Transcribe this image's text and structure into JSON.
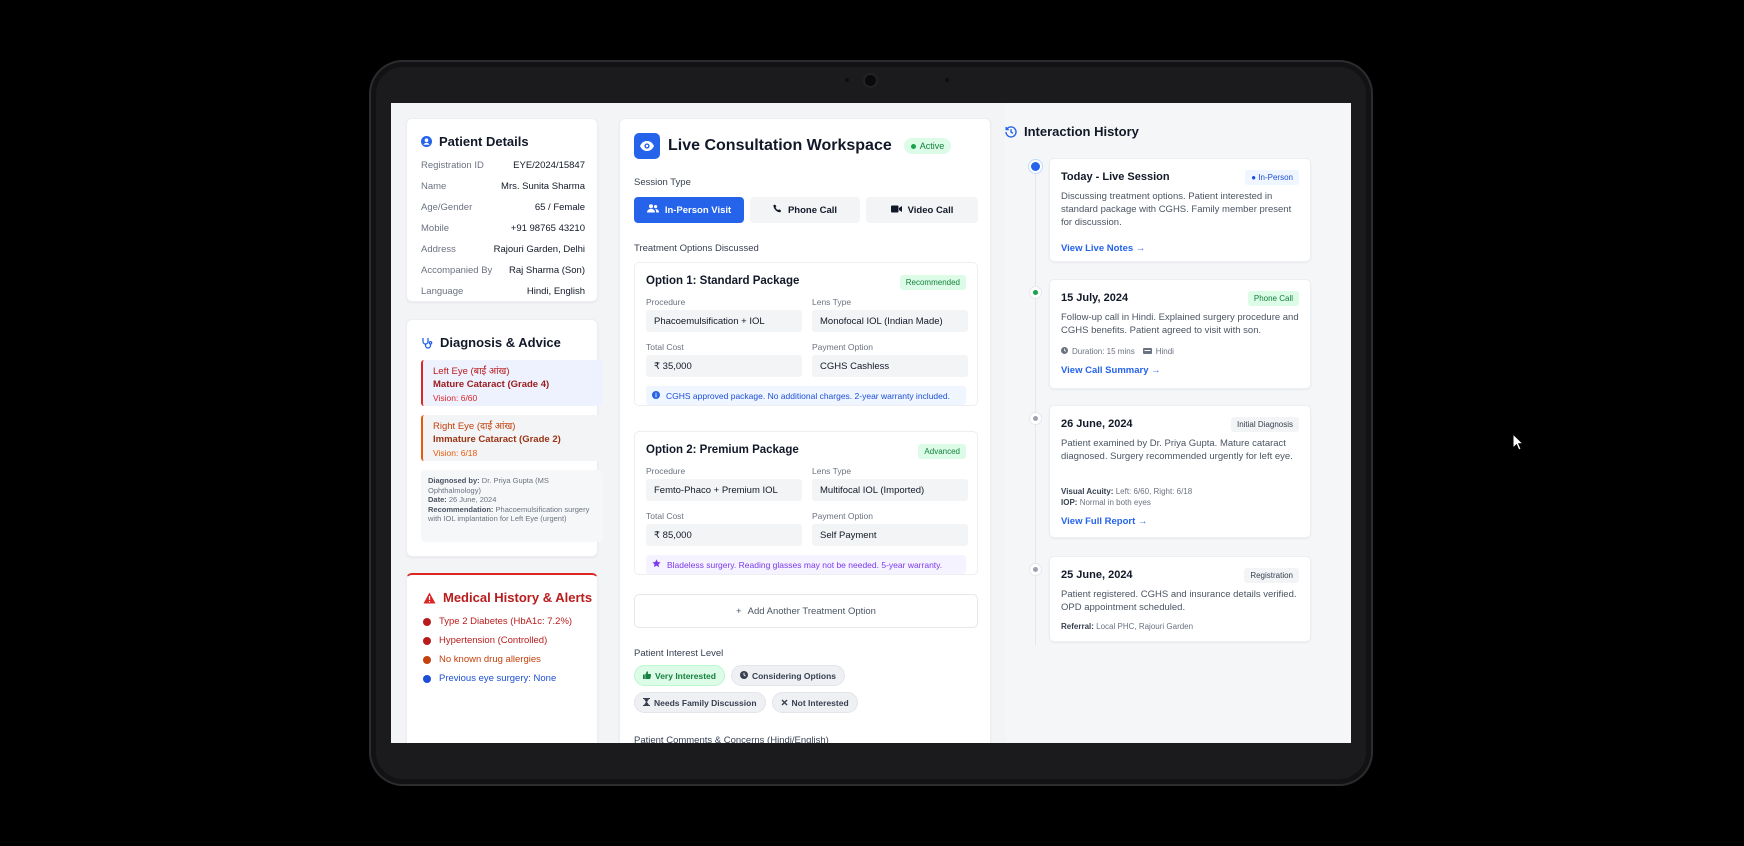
{
  "patient": {
    "title": "Patient Details",
    "rows": [
      {
        "label": "Registration ID",
        "value": "EYE/2024/15847"
      },
      {
        "label": "Name",
        "value": "Mrs. Sunita Sharma"
      },
      {
        "label": "Age/Gender",
        "value": "65 / Female"
      },
      {
        "label": "Mobile",
        "value": "+91 98765 43210"
      },
      {
        "label": "Address",
        "value": "Rajouri Garden, Delhi"
      },
      {
        "label": "Accompanied By",
        "value": "Raj Sharma (Son)"
      },
      {
        "label": "Language",
        "value": "Hindi, English"
      }
    ]
  },
  "diagnosis": {
    "title": "Diagnosis & Advice",
    "left": {
      "eye": "Left Eye (बाईं आंख)",
      "condition": "Mature Cataract (Grade 4)",
      "vision": "Vision: 6/60"
    },
    "right": {
      "eye": "Right Eye (दाईं आंख)",
      "condition": "Immature Cataract (Grade 2)",
      "vision": "Vision: 6/18"
    },
    "notes": {
      "by_label": "Diagnosed by:",
      "by_value": "Dr. Priya Gupta (MS Ophthalmology)",
      "date_label": "Date:",
      "date_value": "26 June, 2024",
      "rec_label": "Recommendation:",
      "rec_value": "Phacoemulsification surgery with IOL implantation for Left Eye (urgent)"
    }
  },
  "history": {
    "title": "Medical History & Alerts",
    "items": [
      {
        "text": "Type 2 Diabetes (HbA1c: 7.2%)",
        "color": "#b91c1c"
      },
      {
        "text": "Hypertension (Controlled)",
        "color": "#b91c1c"
      },
      {
        "text": "No known drug allergies",
        "color": "#c2410c"
      },
      {
        "text": "Previous eye surgery: None",
        "color": "#1d4ed8"
      }
    ]
  },
  "workspace": {
    "title": "Live Consultation Workspace",
    "status": "Active",
    "session_label": "Session Type",
    "sessions": [
      "In-Person Visit",
      "Phone Call",
      "Video Call"
    ],
    "treatment_label": "Treatment Options Discussed",
    "option1": {
      "title": "Option 1: Standard Package",
      "badge": "Recommended",
      "procedure_label": "Procedure",
      "procedure": "Phacoemulsification + IOL",
      "lens_label": "Lens Type",
      "lens": "Monofocal IOL (Indian Made)",
      "cost_label": "Total Cost",
      "cost": "₹ 35,000",
      "payment_label": "Payment Option",
      "payment": "CGHS Cashless",
      "note": "CGHS approved package. No additional charges. 2-year warranty included."
    },
    "option2": {
      "title": "Option 2: Premium Package",
      "badge": "Advanced",
      "procedure_label": "Procedure",
      "procedure": "Femto-Phaco + Premium IOL",
      "lens_label": "Lens Type",
      "lens": "Multifocal IOL (Imported)",
      "cost_label": "Total Cost",
      "cost": "₹ 85,000",
      "payment_label": "Payment Option",
      "payment": "Self Payment",
      "note": "Bladeless surgery. Reading glasses may not be needed. 5-year warranty."
    },
    "add_option": "Add Another Treatment Option",
    "interest_label": "Patient Interest Level",
    "interest": [
      "Very Interested",
      "Considering Options",
      "Needs Family Discussion",
      "Not Interested"
    ],
    "comments_label": "Patient Comments & Concerns (Hindi/English)"
  },
  "timeline": {
    "title": "Interaction History",
    "entries": [
      {
        "title": "Today - Live Session",
        "badge": "In-Person",
        "desc": "Discussing treatment options. Patient interested in standard package with CGHS. Family member present for discussion.",
        "link": "View Live Notes →"
      },
      {
        "title": "15 July, 2024",
        "badge": "Phone Call",
        "desc": "Follow-up call in Hindi. Explained surgery procedure and CGHS benefits. Patient agreed to visit with son.",
        "meta1": "Duration: 15 mins",
        "meta2": "Hindi",
        "link": "View Call Summary →"
      },
      {
        "title": "26 June, 2024",
        "badge": "Initial Diagnosis",
        "desc": "Patient examined by Dr. Priya Gupta. Mature cataract diagnosed. Surgery recommended urgently for left eye.",
        "va_label": "Visual Acuity:",
        "va_value": "Left: 6/60, Right: 6/18",
        "iop_label": "IOP:",
        "iop_value": "Normal in both eyes",
        "link": "View Full Report →"
      },
      {
        "title": "25 June, 2024",
        "badge": "Registration",
        "desc": "Patient registered. CGHS and insurance details verified. OPD appointment scheduled.",
        "ref_label": "Referral:",
        "ref_value": "Local PHC, Rajouri Garden"
      }
    ]
  },
  "colors": {
    "accent": "#2563eb",
    "active_green": "#16a34a",
    "alert_red": "#dc2626"
  }
}
